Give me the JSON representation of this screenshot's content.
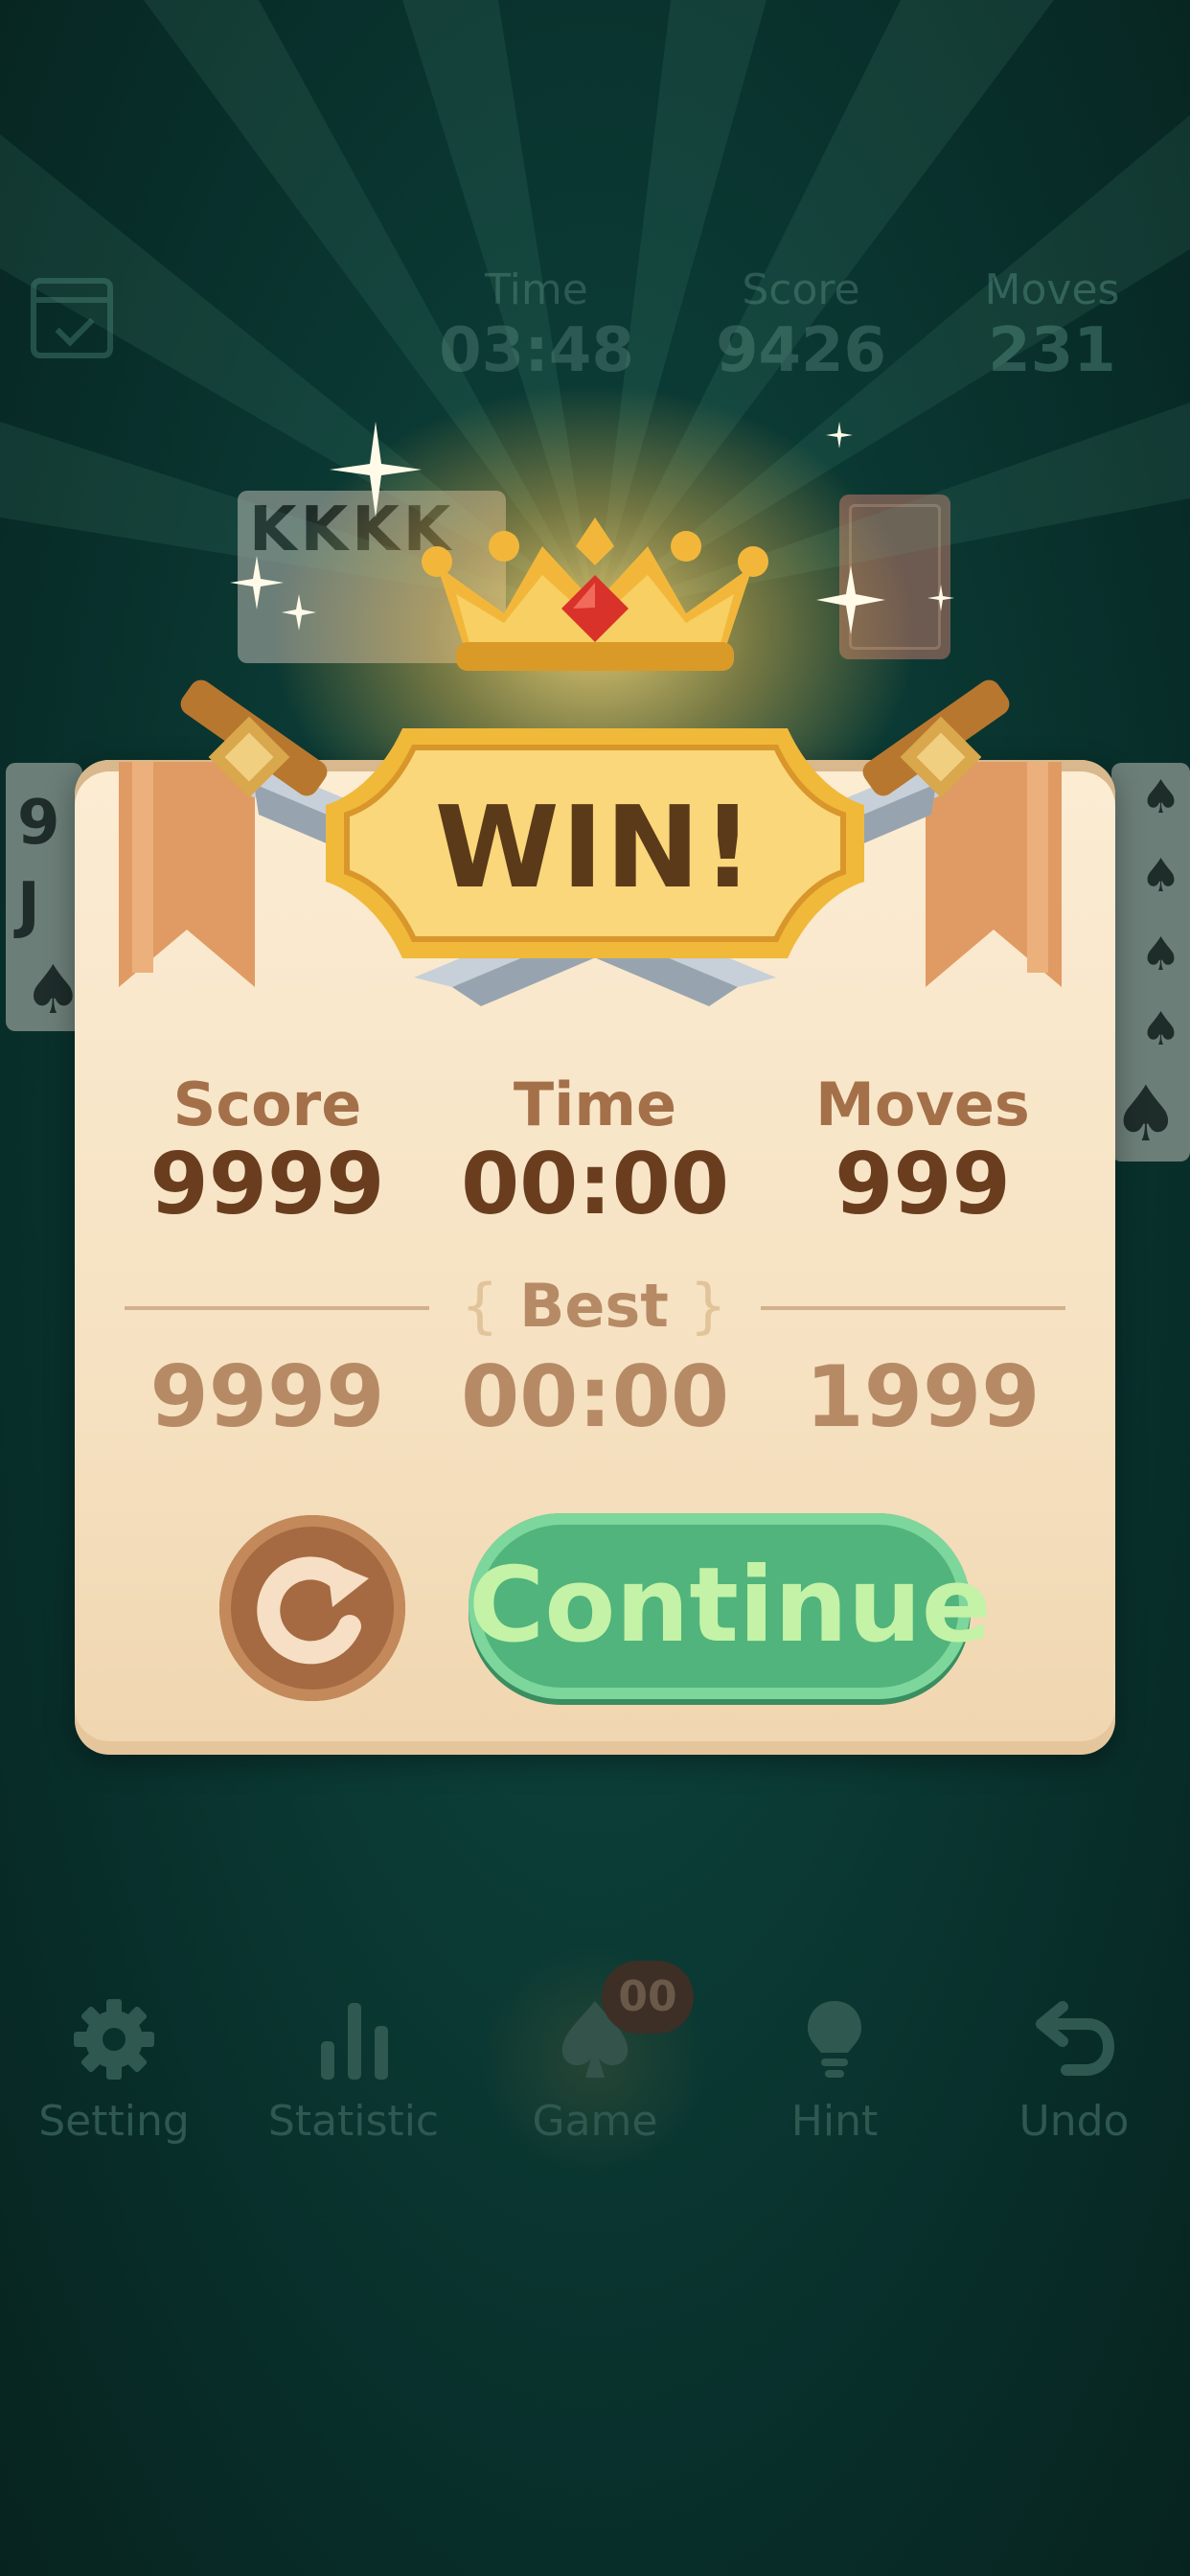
{
  "hud": {
    "time_label": "Time",
    "time_value": "03:48",
    "score_label": "Score",
    "score_value": "9426",
    "moves_label": "Moves",
    "moves_value": "231"
  },
  "background_cards": {
    "foundation_ranks": "KKKK",
    "tableau_left": [
      "9",
      "J"
    ]
  },
  "dialog": {
    "title": "WIN!",
    "current": {
      "score_label": "Score",
      "score_value": "9999",
      "time_label": "Time",
      "time_value": "00:00",
      "moves_label": "Moves",
      "moves_value": "999"
    },
    "best_label": "Best",
    "best": {
      "score": "9999",
      "time": "00:00",
      "moves": "1999"
    },
    "continue_label": "Continue",
    "restart_icon": "restart-arrow-icon"
  },
  "nav": {
    "items": [
      {
        "label": "Setting",
        "icon": "gear-icon"
      },
      {
        "label": "Statistic",
        "icon": "bar-chart-icon"
      },
      {
        "label": "Game",
        "icon": "spade-icon"
      },
      {
        "label": "Hint",
        "icon": "lightbulb-icon"
      },
      {
        "label": "Undo",
        "icon": "undo-icon"
      }
    ],
    "game_badge": "00"
  },
  "colors": {
    "background": "#0b3a34",
    "panel": "#f6e2c2",
    "continue_button": "#50b47c",
    "restart_button": "#a56a42",
    "accent_gold": "#f2b73a"
  }
}
